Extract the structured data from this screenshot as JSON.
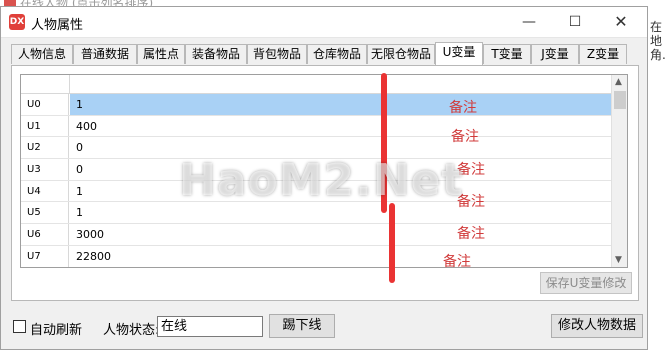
{
  "behind_window": {
    "title": "在线人物 (点击列名排序)",
    "right_edge_text": [
      "在地",
      "角..."
    ]
  },
  "window": {
    "title": "人物属性",
    "icon_text": "DX",
    "minimize_glyph": "—",
    "maximize_glyph": "☐",
    "close_glyph": "✕"
  },
  "tabs": [
    {
      "label": "人物信息"
    },
    {
      "label": "普通数据"
    },
    {
      "label": "属性点"
    },
    {
      "label": "装备物品"
    },
    {
      "label": "背包物品"
    },
    {
      "label": "仓库物品"
    },
    {
      "label": "无限仓物品"
    },
    {
      "label": "U变量",
      "active": true
    },
    {
      "label": "T变量"
    },
    {
      "label": "J变量"
    },
    {
      "label": "Z变量"
    }
  ],
  "grid": {
    "rows": [
      {
        "name": "U0",
        "value": "1",
        "selected": true
      },
      {
        "name": "U1",
        "value": "400"
      },
      {
        "name": "U2",
        "value": "0"
      },
      {
        "name": "U3",
        "value": "0"
      },
      {
        "name": "U4",
        "value": "1"
      },
      {
        "name": "U5",
        "value": "1"
      },
      {
        "name": "U6",
        "value": "3000"
      },
      {
        "name": "U7",
        "value": "22800"
      }
    ],
    "scroll_up_glyph": "▲",
    "scroll_down_glyph": "▼"
  },
  "save_button": {
    "label": "保存U变量修改",
    "enabled": false
  },
  "annotations": {
    "note_label": "备注",
    "color": "#ea3333"
  },
  "watermark": "HaoM2.Net",
  "bottom": {
    "auto_refresh_label": "自动刷新",
    "auto_refresh_checked": false,
    "status_label": "人物状态:",
    "status_value": "在线",
    "kick_button": "踢下线",
    "modify_button": "修改人物数据"
  }
}
